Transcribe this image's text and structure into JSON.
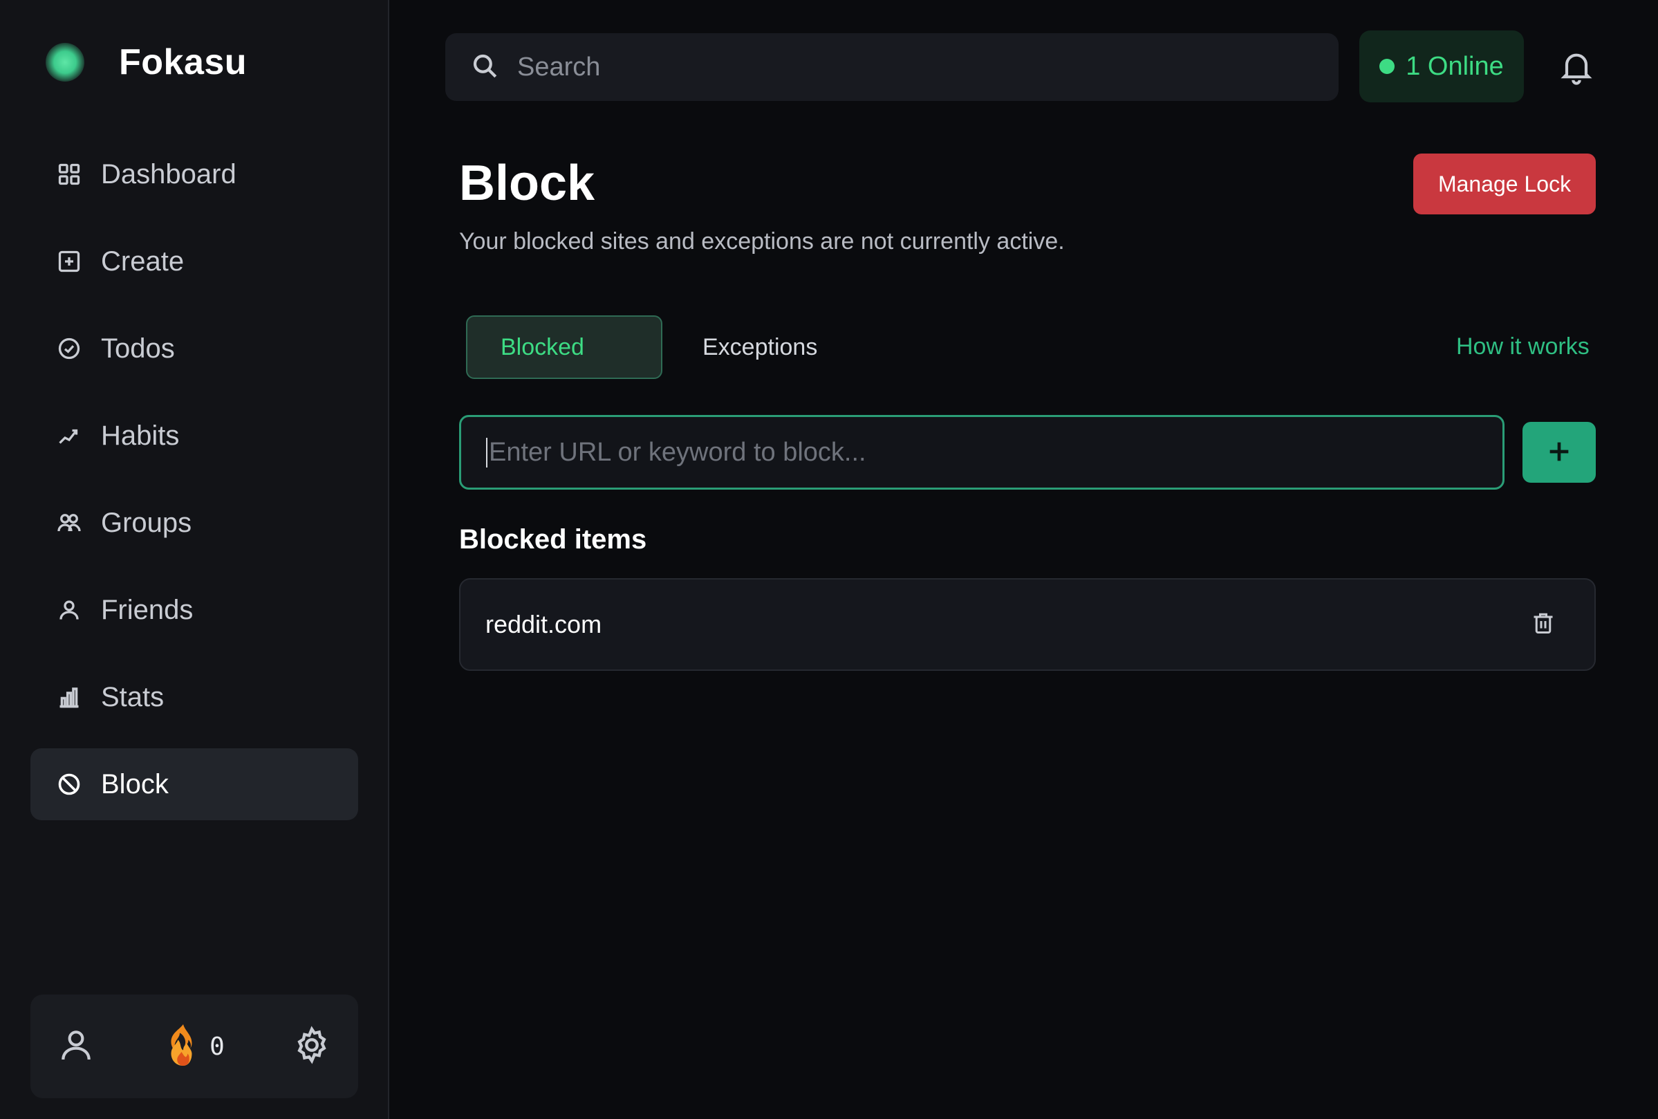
{
  "brand": {
    "name": "Fokasu",
    "accent_color": "#3dcb8c"
  },
  "sidebar": {
    "items": [
      {
        "label": "Dashboard",
        "icon": "grid-icon",
        "active": false
      },
      {
        "label": "Create",
        "icon": "plus-square-icon",
        "active": false
      },
      {
        "label": "Todos",
        "icon": "check-circle-icon",
        "active": false
      },
      {
        "label": "Habits",
        "icon": "trend-icon",
        "active": false
      },
      {
        "label": "Groups",
        "icon": "users-icon",
        "active": false
      },
      {
        "label": "Friends",
        "icon": "user-icon",
        "active": false
      },
      {
        "label": "Stats",
        "icon": "bar-chart-icon",
        "active": false
      },
      {
        "label": "Block",
        "icon": "ban-icon",
        "active": true
      }
    ],
    "footer": {
      "streak_count": "0",
      "icons": [
        "profile-icon",
        "flame-icon",
        "gear-icon"
      ]
    }
  },
  "topbar": {
    "search_placeholder": "Search",
    "online_status": "1 Online",
    "online_color": "#3ddc84"
  },
  "page": {
    "title": "Block",
    "subtitle": "Your blocked sites and exceptions are not currently active.",
    "manage_lock_label": "Manage Lock",
    "manage_lock_color": "#c9383f"
  },
  "tabs": [
    {
      "label": "Blocked",
      "active": true
    },
    {
      "label": "Exceptions",
      "active": false
    }
  ],
  "how_it_works_label": "How it works",
  "block_input": {
    "placeholder": "Enter URL or keyword to block...",
    "value": ""
  },
  "add_button_icon": "plus-icon",
  "blocked_section": {
    "heading": "Blocked items",
    "items": [
      {
        "label": "reddit.com"
      }
    ]
  }
}
